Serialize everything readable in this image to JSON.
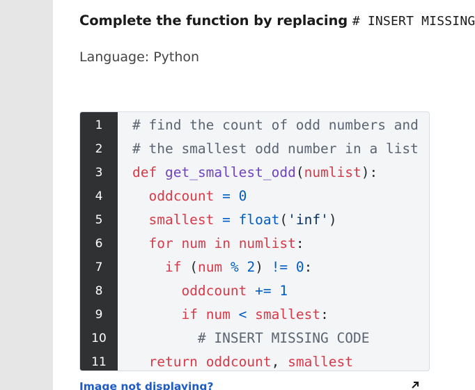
{
  "question": {
    "instruction_text": "Complete the function by replacing ",
    "instruction_code": "# INSERT MISSING CODE",
    "language": "Language: Python"
  },
  "code_block": {
    "line_numbers": [
      "1",
      "2",
      "3",
      "4",
      "5",
      "6",
      "7",
      "8",
      "9",
      "10",
      "11"
    ],
    "lines": [
      "# find the count of odd numbers and",
      "# the smallest odd number in a list",
      "def get_smallest_odd(numlist):",
      "  oddcount = 0",
      "  smallest = float('inf')",
      "  for num in numlist:",
      "    if (num % 2) != 0:",
      "      oddcount += 1",
      "      if num < smallest:",
      "        # INSERT MISSING CODE",
      "  return oddcount, smallest"
    ]
  },
  "footer": {
    "image_link": "Image not displaying?",
    "expand_icon": "external-expand-icon"
  }
}
